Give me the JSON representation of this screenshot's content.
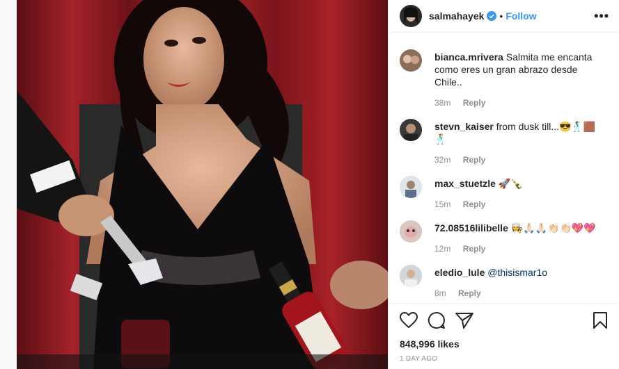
{
  "post": {
    "username": "salmahayek",
    "separator": "•",
    "follow_label": "Follow",
    "more_label": "•••"
  },
  "comments": [
    {
      "username": "bianca.mrivera",
      "text": "Salmita me encanta como eres un gran abrazo desde Chile..",
      "time": "38m",
      "reply": "Reply"
    },
    {
      "username": "stevn_kaiser",
      "text": "from dusk till...😎🕺🏽🟫🕺",
      "time": "32m",
      "reply": "Reply"
    },
    {
      "username": "max_stuetzle",
      "text": "🚀🍾",
      "time": "15m",
      "reply": "Reply"
    },
    {
      "username": "72.08516lilibelle",
      "text": "👩‍🍳🙏🏻🙏🏻👏🏻👏🏻💖💖",
      "time": "12m",
      "reply": "Reply"
    },
    {
      "username": "eledio_lule",
      "text": "@thisismar1o",
      "time": "8m",
      "reply": "Reply"
    }
  ],
  "footer": {
    "likes": "848,996 likes",
    "time_ago": "1 DAY AGO"
  },
  "colors": {
    "accent": "#3897f0",
    "muted": "#8e8e8e",
    "text": "#262626"
  }
}
